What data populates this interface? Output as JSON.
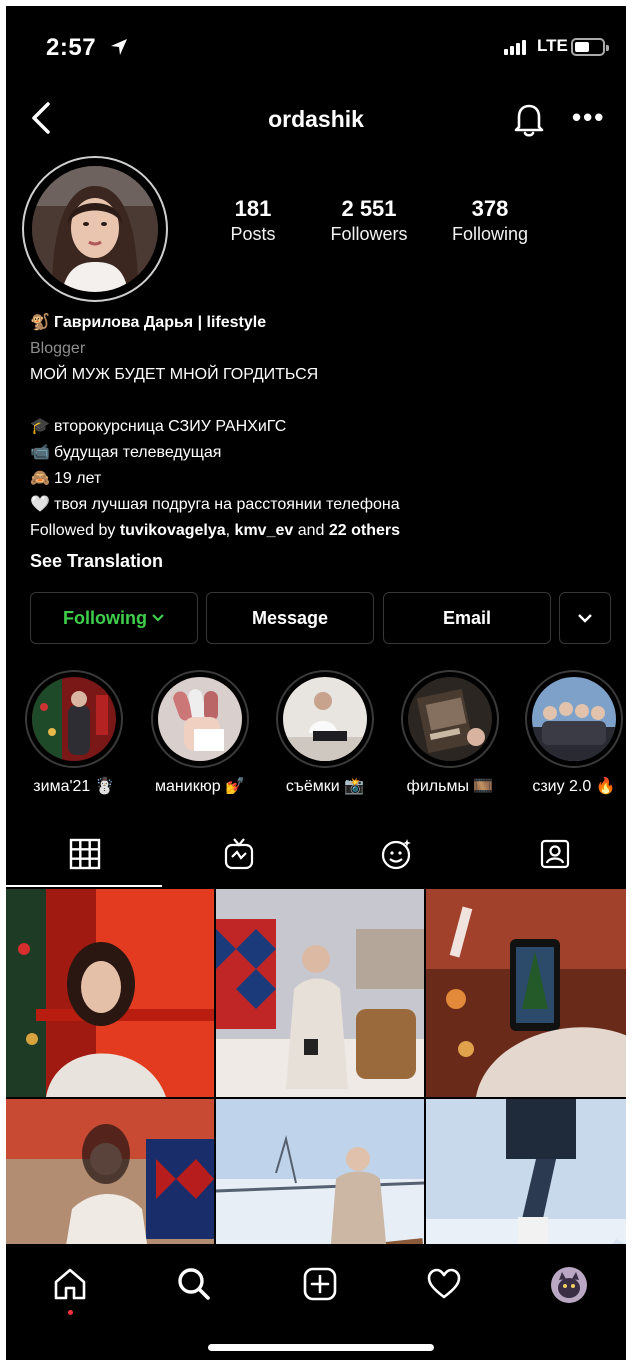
{
  "status_bar": {
    "time": "2:57",
    "network": "LTE"
  },
  "header": {
    "username": "ordashik"
  },
  "stats": [
    {
      "value": "181",
      "label": "Posts"
    },
    {
      "value": "2 551",
      "label": "Followers"
    },
    {
      "value": "378",
      "label": "Following"
    }
  ],
  "bio": {
    "name_emoji": "🐒",
    "name": "Гаврилова Дарья | lifestyle",
    "category": "Blogger",
    "line1": "МОЙ МУЖ БУДЕТ МНОЙ ГОРДИТЬСЯ",
    "lines": [
      {
        "emoji": "🎓",
        "text": "второкурсница СЗИУ РАНХиГС"
      },
      {
        "emoji": "📹",
        "text": "будущая телеведущая"
      },
      {
        "emoji": "🙈",
        "text": "19 лет"
      },
      {
        "emoji": "🤍",
        "text": "твоя лучшая подруга на расстоянии телефона"
      }
    ],
    "followed_prefix": "Followed by ",
    "followed_user1": "tuvikovagelya",
    "followed_sep": ", ",
    "followed_user2": "kmv_ev",
    "followed_and": " and ",
    "followed_others": "22 others",
    "see_translation": "See Translation"
  },
  "buttons": {
    "following": "Following",
    "message": "Message",
    "email": "Email"
  },
  "highlights": [
    {
      "label": "зима'21 ☃️"
    },
    {
      "label": "маникюр 💅"
    },
    {
      "label": "съёмки 📸"
    },
    {
      "label": "фильмы 🎞️"
    },
    {
      "label": "сзиу 2.0 🔥"
    }
  ],
  "colors": {
    "following_green": "#3ecf4a",
    "background": "#000000",
    "notification_dot": "#ff3040"
  },
  "tab_icons": [
    "grid-icon",
    "igtv-icon",
    "reels-effects-icon",
    "tagged-icon"
  ],
  "bottom_nav_icons": [
    "home-icon",
    "search-icon",
    "new-post-icon",
    "activity-heart-icon",
    "profile-avatar"
  ]
}
